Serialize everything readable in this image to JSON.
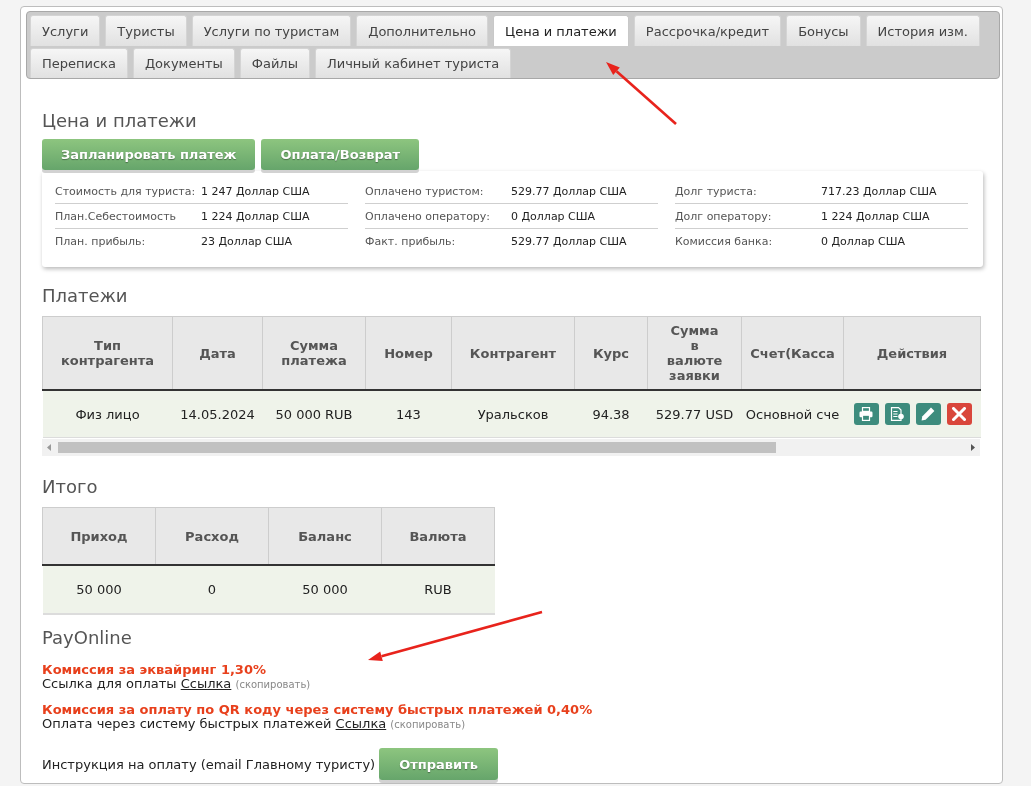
{
  "tab_rows": [
    [
      {
        "label": "Услуги",
        "selected": false
      },
      {
        "label": "Туристы",
        "selected": false
      },
      {
        "label": "Услуги по туристам",
        "selected": false
      },
      {
        "label": "Дополнительно",
        "selected": false
      },
      {
        "label": "Цена и платежи",
        "selected": true
      },
      {
        "label": "Рассрочка/кредит",
        "selected": false
      },
      {
        "label": "Бонусы",
        "selected": false
      },
      {
        "label": "История изм.",
        "selected": false
      }
    ],
    [
      {
        "label": "Переписка",
        "selected": false
      },
      {
        "label": "Документы",
        "selected": false
      },
      {
        "label": "Файлы",
        "selected": false
      },
      {
        "label": "Личный кабинет туриста",
        "selected": false
      }
    ]
  ],
  "title": "Цена и платежи",
  "action_buttons": [
    "Запланировать платеж",
    "Оплата/Возврат"
  ],
  "summary": [
    [
      {
        "label": "Стоимость для туриста:",
        "value": "1 247 Доллар США"
      },
      {
        "label": "План.Себестоимость",
        "value": "1 224 Доллар США"
      },
      {
        "label": "План. прибыль:",
        "value": "23 Доллар США"
      }
    ],
    [
      {
        "label": "Оплачено туристом:",
        "value": "529.77 Доллар США"
      },
      {
        "label": "Оплачено оператору:",
        "value": "0 Доллар США"
      },
      {
        "label": "Факт. прибыль:",
        "value": "529.77 Доллар США"
      }
    ],
    [
      {
        "label": "Долг туриста:",
        "value": "717.23 Доллар США"
      },
      {
        "label": "Долг оператору:",
        "value": "1 224 Доллар США"
      },
      {
        "label": "Комиссия банка:",
        "value": "0 Доллар США"
      }
    ]
  ],
  "payments": {
    "title": "Платежи",
    "columns": [
      "Тип контрагента",
      "Дата",
      "Сумма платежа",
      "Номер",
      "Контрагент",
      "Курс",
      "Сумма в валюте заявки",
      "Счет(Касса",
      "Действия"
    ],
    "rows": [
      {
        "cells": [
          "Физ лицо",
          "14.05.2024",
          "50 000 RUB",
          "143",
          "Уральсков",
          "94.38",
          "529.77 USD",
          "Основной сче"
        ],
        "actions": [
          {
            "kind": "print"
          },
          {
            "kind": "document"
          },
          {
            "kind": "edit"
          },
          {
            "kind": "delete"
          }
        ]
      }
    ]
  },
  "totals": {
    "title": "Итого",
    "columns": [
      "Приход",
      "Расход",
      "Баланс",
      "Валюта"
    ],
    "rows": [
      [
        "50 000",
        "0",
        "50 000",
        "RUB"
      ]
    ]
  },
  "payonline": {
    "title": "PayOnline",
    "options": [
      {
        "commission": "Комиссия за эквайринг 1,30%",
        "label": "Ссылка для оплаты",
        "link": "Ссылка",
        "copy": "(скопировать)"
      },
      {
        "commission": "Комиссия за оплату по QR коду через систему быстрых платежей 0,40%",
        "label": "Оплата через систему быстрых платежей",
        "link": "Ссылка",
        "copy": "(скопировать)"
      }
    ],
    "instruction": "Инструкция на оплату (email Главному туристу)",
    "send_button": "Отправить"
  }
}
